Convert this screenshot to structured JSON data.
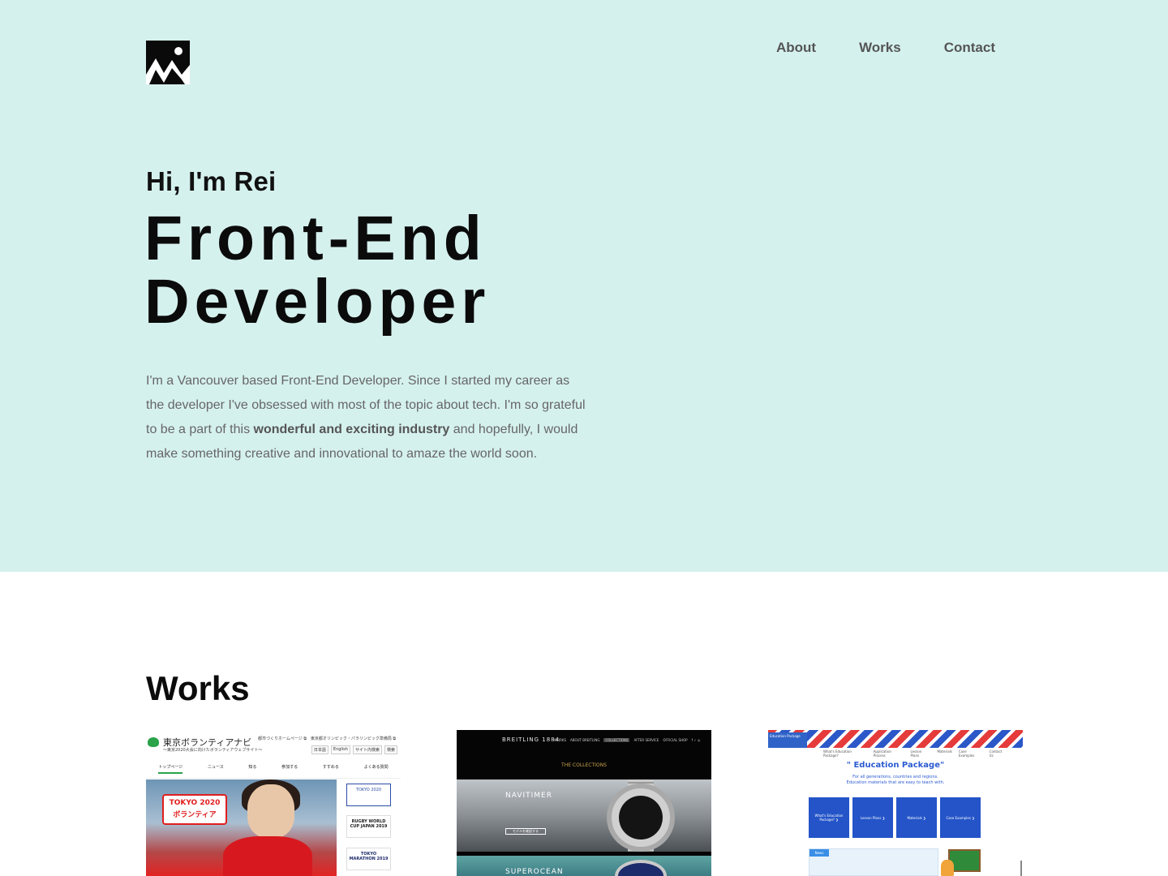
{
  "header": {
    "logo_icon": "mountain-image-icon",
    "nav": [
      "About",
      "Works",
      "Contact"
    ]
  },
  "hero": {
    "greeting": "Hi, I'm Rei",
    "headline_line1": "Front-End",
    "headline_line2": "Developer",
    "intro_part1": "I'm a Vancouver based Front-End Developer. Since I started my career as the developer I've obsessed with most of the topic about tech. I'm so grateful to be a part of this ",
    "intro_bold": "wonderful and exciting industry",
    "intro_part2": " and hopefully, I would make something creative and innovational to amaze the world soon.",
    "background_color": "#d5f1ee"
  },
  "works": {
    "title": "Works",
    "items": [
      {
        "site_title": "東京ボランティアナビ",
        "site_subtitle": "〜東京2020大会に向けたボランティアウェブサイト〜",
        "header_links": "都市づくりホームページ ⧉　東京都オリンピック・パラリンピック準備局 ⧉",
        "search_lang": [
          "日本語",
          "English",
          "サイト内検索",
          "検索"
        ],
        "nav": [
          "トップページ",
          "ニュース",
          "知る",
          "参加する",
          "すすめる",
          "よくある質問"
        ],
        "banner_badge_line1": "TOKYO 2020",
        "banner_badge_line2": "ボランティア",
        "side_tiles": [
          "TOKYO 2020",
          "RUGBY WORLD CUP JAPAN 2019",
          "TOKYO MARATHON 2019"
        ]
      },
      {
        "brand": "BREITLING 1884",
        "nav": [
          "WORKS",
          "ABOUT BREITLING",
          "COLLECTIONS",
          "AFTER SERVICE",
          "OFFICIAL SHOP",
          "f ✓ ◎"
        ],
        "section_label": "THE COLLECTIONS",
        "collection1": "NAVITIMER",
        "collection1_button": "モデルを確認する",
        "collection2": "SUPEROCEAN"
      },
      {
        "logo_text": "Education Package",
        "menu": [
          "What's Education Package?",
          "Application Process",
          "Lesson Plans",
          "Materials",
          "Case Examples",
          "Contact Us"
        ],
        "title": "\" Education Package\"",
        "subtitle_line1": "For all generations, countries and regions.",
        "subtitle_line2": "Education materials that are easy to teach with.",
        "buttons": [
          "What's Education Package? ❯",
          "Lesson Plans ❯",
          "Materials ❯",
          "Case Examples ❯"
        ],
        "news_label": "News"
      }
    ]
  }
}
